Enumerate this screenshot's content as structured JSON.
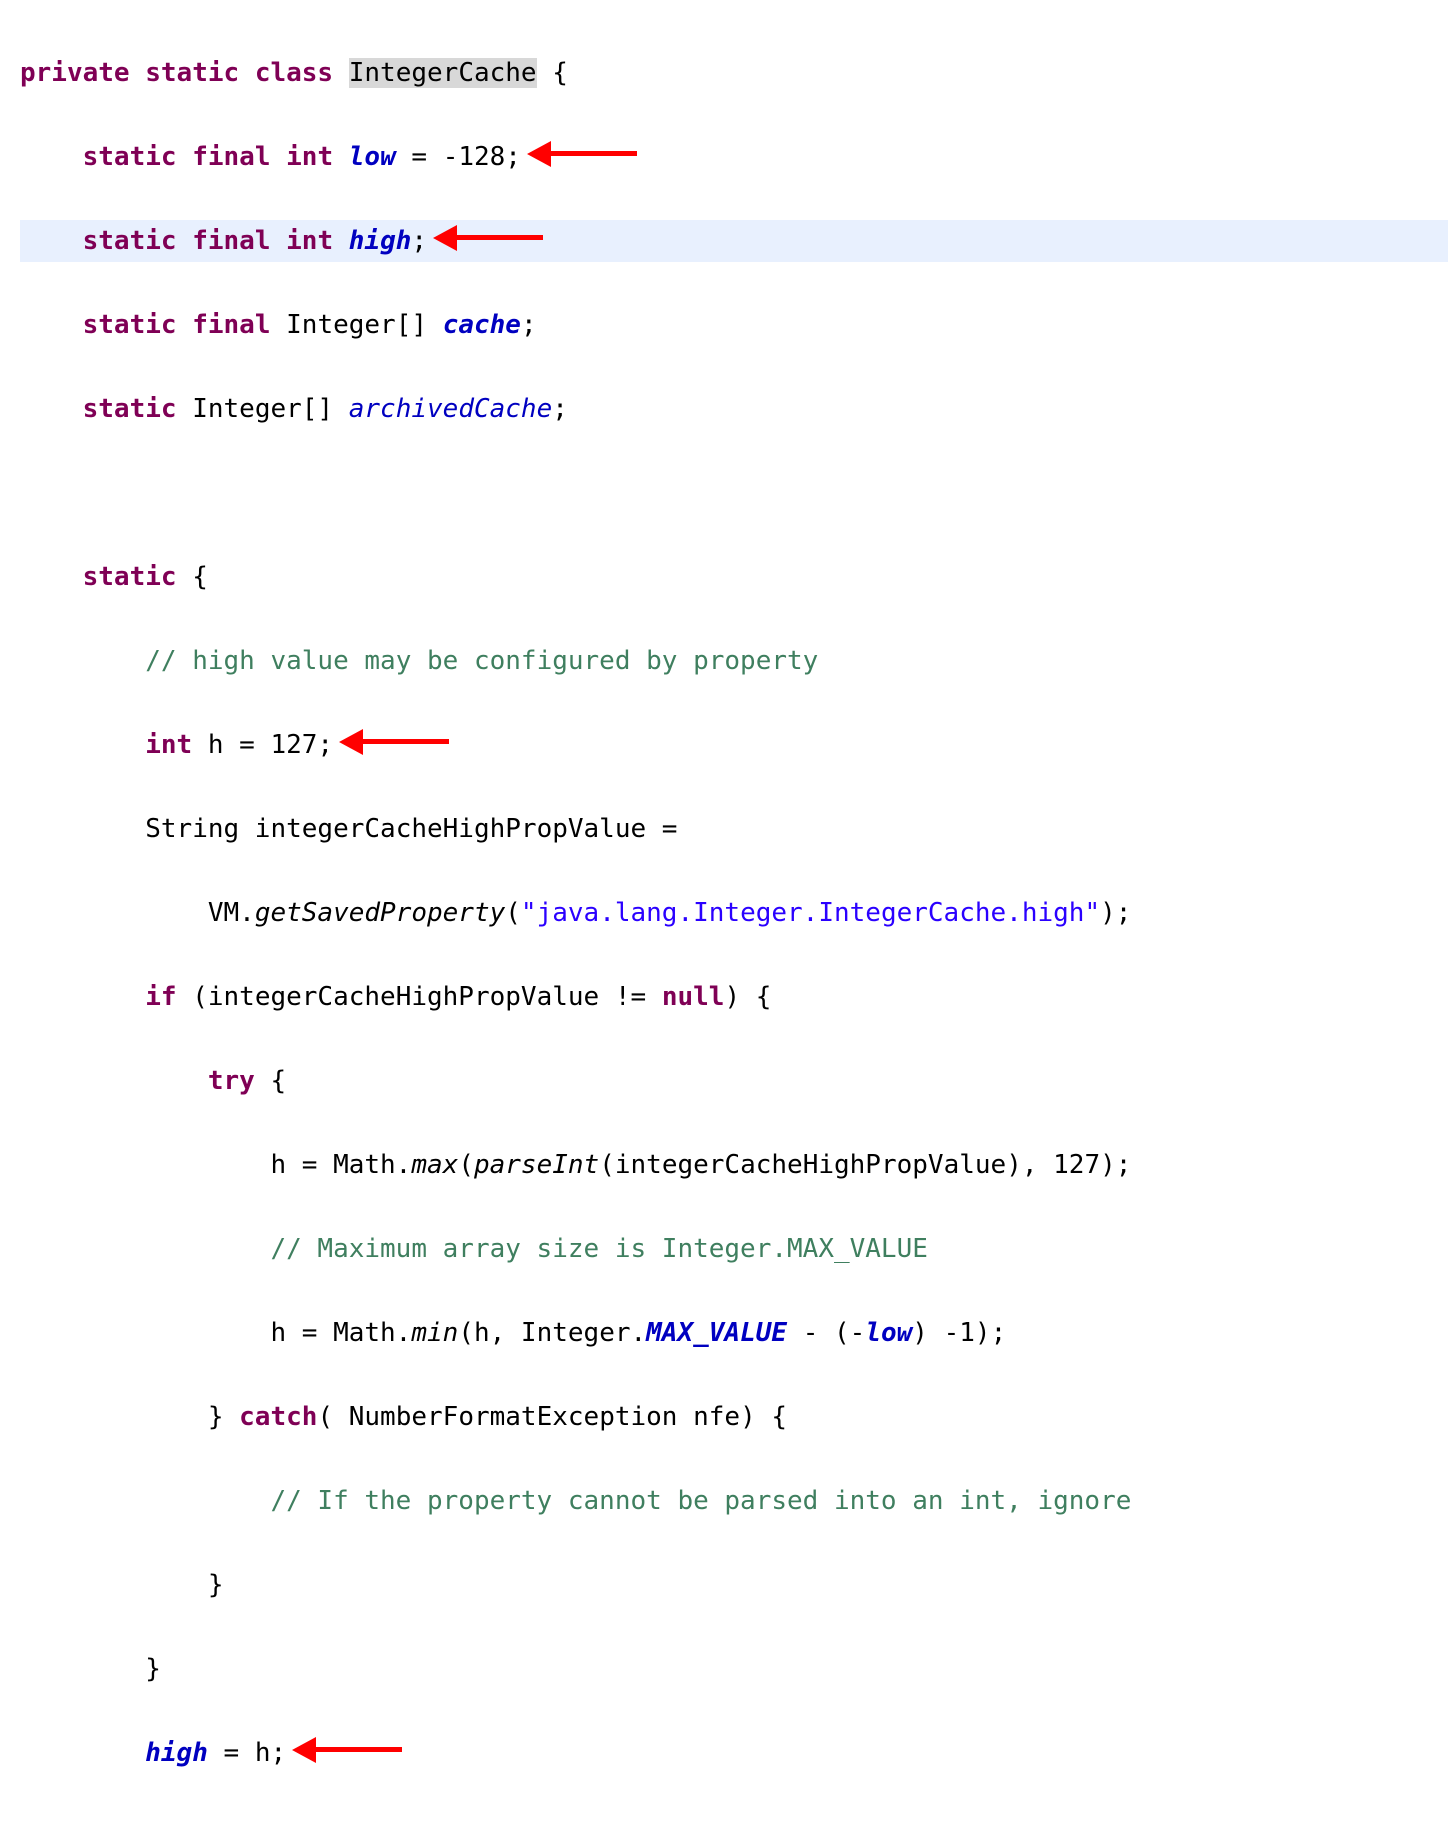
{
  "lines": {
    "l1": {
      "kw1": "private",
      "kw2": "static",
      "kw3": "class",
      "cls": "IntegerCache",
      "b": " {"
    },
    "l2": {
      "kw1": "static",
      "kw2": "final",
      "kw3": "int",
      "f": "low",
      "rest": " = -128;"
    },
    "l3": {
      "kw1": "static",
      "kw2": "final",
      "kw3": "int",
      "f": "high",
      "rest": ";"
    },
    "l4": {
      "kw1": "static",
      "kw2": "final",
      "t": " Integer[]",
      "f": "cache",
      "rest": ";"
    },
    "l5": {
      "kw1": "static",
      "t": " Integer[]",
      "f": "archivedCache",
      "rest": ";"
    },
    "l6": {
      "kw1": "static",
      "b": " {"
    },
    "l7": {
      "c": "// high value may be configured by property"
    },
    "l8": {
      "kw1": "int",
      "rest": " h = 127;"
    },
    "l9": {
      "a": "String integerCacheHighPropValue ="
    },
    "l10": {
      "a": "VM.",
      "m": "getSavedProperty",
      "b": "(",
      "s": "\"java.lang.Integer.IntegerCache.high\"",
      "c": ");"
    },
    "l11": {
      "kw1": "if",
      "a": " (integerCacheHighPropValue != ",
      "kw2": "null",
      "b": ") {"
    },
    "l12": {
      "kw1": "try",
      "b": " {"
    },
    "l13": {
      "a": "h = Math.",
      "m": "max",
      "b": "(",
      "m2": "parseInt",
      "c": "(integerCacheHighPropValue), 127);"
    },
    "l14": {
      "c": "// Maximum array size is Integer.MAX_VALUE"
    },
    "l15": {
      "a": "h = Math.",
      "m": "min",
      "b": "(h, Integer.",
      "f": "MAX_VALUE",
      "c": " - (-",
      "f2": "low",
      "d": ") -1);"
    },
    "l16": {
      "a": "} ",
      "kw1": "catch",
      "b": "( NumberFormatException nfe) {"
    },
    "l17": {
      "c": "// If the property cannot be parsed into an int, ignore"
    },
    "l18": {
      "a": "}"
    },
    "l19": {
      "a": "}"
    },
    "l20": {
      "f": "high",
      "a": " = h;"
    }
  }
}
